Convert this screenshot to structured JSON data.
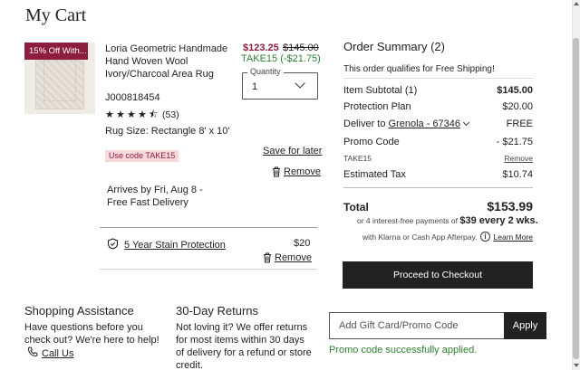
{
  "page": {
    "title": "My Cart"
  },
  "item": {
    "badge": "15% Off With...",
    "name": "Loria Geometric Handmade Hand Woven Wool Ivory/Charcoal Area Rug",
    "sku": "J000818454",
    "rating_value": 4.5,
    "rating_count": "(53)",
    "size": "Rug Size: Rectangle 8' x 10'",
    "use_code": "Use code TAKE15",
    "price_sale": "$123.25",
    "price_original": "$145.00",
    "promo_line": "TAKE15 (-$21.75)",
    "quantity_label": "Quantity",
    "quantity_value": "1",
    "save_for_later": "Save for later",
    "remove": "Remove",
    "arrives": "Arrives by Fri, Aug 8 - Free Fast Delivery"
  },
  "protection": {
    "label": "5 Year Stain Protection",
    "price": "$20",
    "remove": "Remove"
  },
  "summary": {
    "title": "Order Summary (2)",
    "free_shipping": "This order qualifies for Free Shipping!",
    "rows": {
      "subtotal": {
        "label": "Item Subtotal (1)",
        "value": "$145.00"
      },
      "protection": {
        "label": "Protection Plan",
        "value": "$20.00"
      },
      "deliver": {
        "label_prefix": "Deliver to ",
        "location": "Grenola - 67346",
        "value": "FREE"
      },
      "promo": {
        "label": "Promo Code",
        "value": "- $21.75"
      },
      "promo_code": {
        "label": "TAKE15",
        "value": "Remove"
      },
      "tax": {
        "label": "Estimated Tax",
        "value": "$10.74"
      }
    },
    "total_label": "Total",
    "total_value": "$153.99",
    "installments_prefix": "or 4 interest-free payments of ",
    "installments_amount": "$39 every 2 wks.",
    "klarna_text": "with Klarna or Cash App Afterpay.",
    "learn_more": "Learn More",
    "checkout": "Proceed to Checkout"
  },
  "assistance": {
    "title": "Shopping Assistance",
    "text": "Have questions before you check out? We're here to help!",
    "call": "Call Us"
  },
  "returns": {
    "title": "30-Day Returns",
    "text": "Not loving it? We offer returns for most items within 30 days of delivery for a refund or store credit."
  },
  "gift": {
    "placeholder": "Add Gift Card/Promo Code",
    "apply": "Apply",
    "success": "Promo code successfully applied."
  },
  "icons": {
    "star": "star-icon",
    "trash": "trash-icon",
    "shield": "shield-check-icon",
    "phone": "phone-icon",
    "info": "info-icon",
    "chevron": "chevron-down-icon"
  },
  "colors": {
    "brand_red": "#8c1d3e",
    "success_green": "#2e7d32",
    "button_dark": "#222222"
  }
}
